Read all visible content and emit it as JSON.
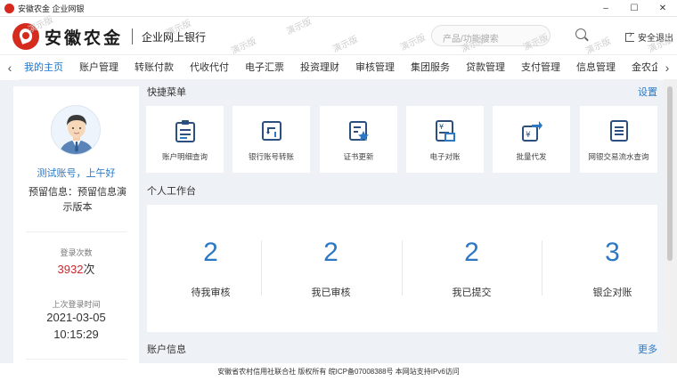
{
  "window": {
    "title": "安徽农金 企业网银",
    "btn_min": "–",
    "btn_max": "☐",
    "btn_close": "✕"
  },
  "header": {
    "logo_text": "安徽农金",
    "logo_sub": "企业网上银行",
    "search_placeholder": "产品/功能搜索",
    "logout_label": "安全退出",
    "watermark_text": "演示版"
  },
  "nav": {
    "prev": "‹",
    "next": "›",
    "items": [
      "我的主页",
      "账户管理",
      "转账付款",
      "代收代付",
      "电子汇票",
      "投资理财",
      "审核管理",
      "集团服务",
      "贷款管理",
      "支付管理",
      "信息管理",
      "金农企付"
    ]
  },
  "user": {
    "greeting": "测试账号，上午好",
    "notice": "预留信息：预留信息演示版本",
    "login_count_label": "登录次数",
    "login_count": "3932",
    "login_count_unit": "次",
    "last_login_label": "上次登录时间",
    "last_login_date": "2021-03-05",
    "last_login_time": "10:15:29"
  },
  "quick_menu": {
    "title": "快捷菜单",
    "settings_label": "设置",
    "items": [
      {
        "label": "账户明细查询",
        "icon": "clipboard-list-icon"
      },
      {
        "label": "银行账号转账",
        "icon": "transfer-icon"
      },
      {
        "label": "证书更新",
        "icon": "certificate-icon"
      },
      {
        "label": "电子对账",
        "icon": "reconciliation-icon"
      },
      {
        "label": "批量代发",
        "icon": "batch-payment-icon"
      },
      {
        "label": "网银交易流水查询",
        "icon": "transaction-list-icon"
      }
    ]
  },
  "workbench": {
    "title": "个人工作台",
    "items": [
      {
        "count": "2",
        "label": "待我审核"
      },
      {
        "count": "2",
        "label": "我已审核"
      },
      {
        "count": "2",
        "label": "我已提交"
      },
      {
        "count": "3",
        "label": "银企对账"
      }
    ]
  },
  "account_info": {
    "title": "账户信息",
    "more_label": "更多"
  },
  "footer": {
    "text": "安徽省农村信用社联合社 版权所有 皖ICP备07008388号 本网站支持IPv6访问"
  },
  "colors": {
    "accent": "#2b78c4",
    "brand_red": "#d52b1e",
    "count_red": "#d0262b"
  }
}
